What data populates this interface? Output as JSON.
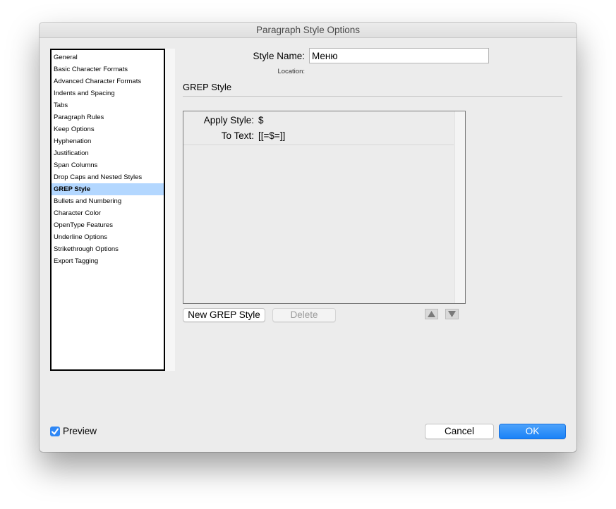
{
  "window": {
    "title": "Paragraph Style Options"
  },
  "sidebar": {
    "selected_index": 11,
    "items": [
      {
        "label": "General"
      },
      {
        "label": "Basic Character Formats"
      },
      {
        "label": "Advanced Character Formats"
      },
      {
        "label": "Indents and Spacing"
      },
      {
        "label": "Tabs"
      },
      {
        "label": "Paragraph Rules"
      },
      {
        "label": "Keep Options"
      },
      {
        "label": "Hyphenation"
      },
      {
        "label": "Justification"
      },
      {
        "label": "Span Columns"
      },
      {
        "label": "Drop Caps and Nested Styles"
      },
      {
        "label": "GREP Style"
      },
      {
        "label": "Bullets and Numbering"
      },
      {
        "label": "Character Color"
      },
      {
        "label": "OpenType Features"
      },
      {
        "label": "Underline Options"
      },
      {
        "label": "Strikethrough Options"
      },
      {
        "label": "Export Tagging"
      }
    ]
  },
  "style_name": {
    "label": "Style Name:",
    "value": "Меню"
  },
  "location": {
    "label": "Location:"
  },
  "section": {
    "title": "GREP Style"
  },
  "grep": {
    "apply_style_label": "Apply Style:",
    "apply_style_value": "$",
    "to_text_label": "To Text:",
    "to_text_value": "[[=$=]]",
    "new_button": "New GREP Style",
    "delete_button": "Delete"
  },
  "footer": {
    "preview_label": "Preview",
    "preview_checked": true,
    "cancel_button": "Cancel",
    "ok_button": "OK"
  },
  "colors": {
    "accent": "#1a82f7",
    "selection": "#b3d7ff"
  }
}
